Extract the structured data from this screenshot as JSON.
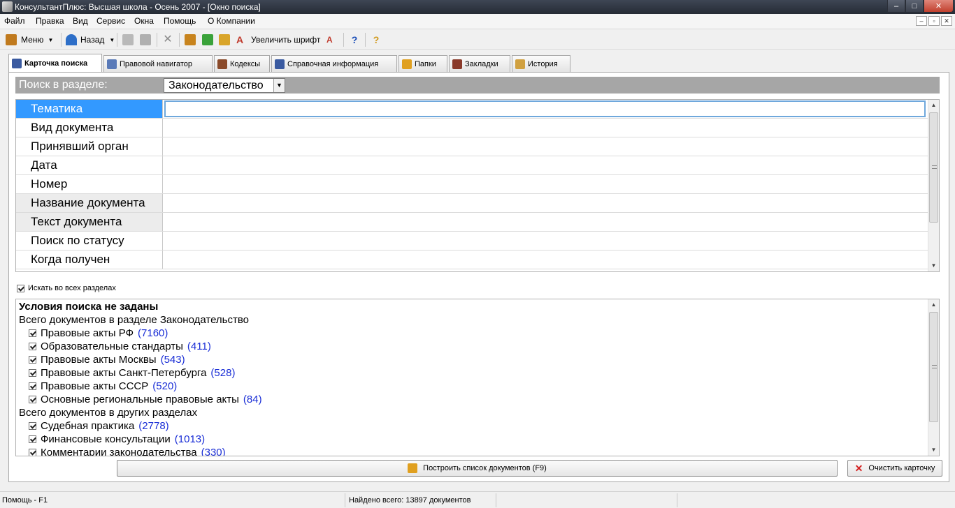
{
  "window": {
    "title": "КонсультантПлюс: Высшая школа - Осень 2007 - [Окно поиска]",
    "minimize": "–",
    "maximize": "□",
    "close": "✕"
  },
  "menubar": {
    "items": [
      "Файл",
      "Правка",
      "Вид",
      "Сервис",
      "Окна",
      "Помощь",
      "О Компании"
    ],
    "mdi": [
      "–",
      "▫",
      "✕"
    ]
  },
  "toolbar": {
    "menu_label": "Меню",
    "back_label": "Назад",
    "font_label": "Увеличить шрифт",
    "dropdown_arrow": "▼"
  },
  "tabs": [
    {
      "label": "Карточка поиска",
      "active": true
    },
    {
      "label": "Правовой навигатор"
    },
    {
      "label": "Кодексы"
    },
    {
      "label": "Справочная информация"
    },
    {
      "label": "Папки"
    },
    {
      "label": "Закладки"
    },
    {
      "label": "История"
    }
  ],
  "section": {
    "label": "Поиск в разделе:",
    "value": "Законодательство",
    "arrow": "▼"
  },
  "fields": [
    "Тематика",
    "Вид документа",
    "Принявший орган",
    "Дата",
    "Номер",
    "Название документа",
    "Текст документа",
    "Поиск по статусу",
    "Когда получен"
  ],
  "search_all_label": "Искать во всех разделах",
  "results": {
    "heading": "Условия поиска не заданы",
    "group1": "Всего документов в разделе Законодательство",
    "group1_items": [
      {
        "label": "Правовые акты РФ",
        "count": "(7160)"
      },
      {
        "label": "Образовательные стандарты",
        "count": "(411)"
      },
      {
        "label": "Правовые акты Москвы",
        "count": "(543)"
      },
      {
        "label": "Правовые акты Санкт-Петербурга",
        "count": "(528)"
      },
      {
        "label": "Правовые акты СССР",
        "count": "(520)"
      },
      {
        "label": "Основные региональные правовые акты",
        "count": "(84)"
      }
    ],
    "group2": "Всего документов в других разделах",
    "group2_items": [
      {
        "label": "Судебная практика",
        "count": "(2778)"
      },
      {
        "label": "Финансовые консультации",
        "count": "(1013)"
      },
      {
        "label": "Комментарии законодательства",
        "count": "(330)"
      }
    ]
  },
  "buttons": {
    "build_list": "Построить список документов (F9)",
    "clear_card": "Очистить карточку"
  },
  "status": {
    "help": "Помощь - F1",
    "found": "Найдено всего: 13897 документов"
  },
  "colors": {
    "selected_row": "#3399ff",
    "count_link": "#1a2ed6",
    "section_bar": "#a6a6a6"
  }
}
